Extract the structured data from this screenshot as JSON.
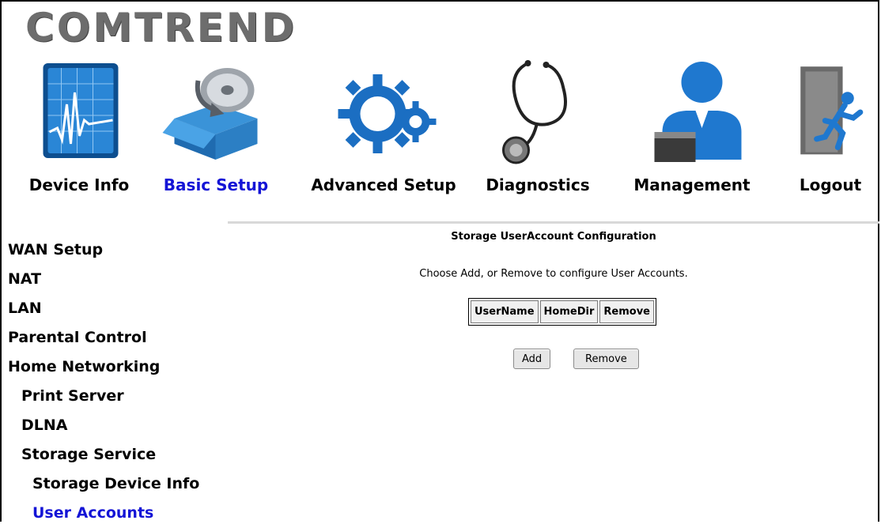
{
  "brand": {
    "logo_text": "COMTREND"
  },
  "nav": {
    "items": [
      {
        "label": "Device Info",
        "icon": "device-info-monitor-icon"
      },
      {
        "label": "Basic Setup",
        "icon": "basic-setup-box-disc-icon",
        "active": true
      },
      {
        "label": "Advanced Setup",
        "icon": "advanced-setup-gears-icon"
      },
      {
        "label": "Diagnostics",
        "icon": "diagnostics-stethoscope-icon"
      },
      {
        "label": "Management",
        "icon": "management-user-icon"
      },
      {
        "label": "Logout",
        "icon": "logout-door-runner-icon"
      }
    ]
  },
  "sidebar": {
    "items": [
      {
        "label": "WAN Setup",
        "level": 0
      },
      {
        "label": "NAT",
        "level": 0
      },
      {
        "label": "LAN",
        "level": 0
      },
      {
        "label": "Parental Control",
        "level": 0
      },
      {
        "label": "Home Networking",
        "level": 0
      },
      {
        "label": "Print Server",
        "level": 1
      },
      {
        "label": "DLNA",
        "level": 1
      },
      {
        "label": "Storage Service",
        "level": 1
      },
      {
        "label": "Storage Device Info",
        "level": 2
      },
      {
        "label": "User Accounts",
        "level": 2,
        "active": true
      }
    ]
  },
  "main": {
    "title": "Storage UserAccount Configuration",
    "description": "Choose Add, or Remove to configure User Accounts.",
    "table": {
      "columns": [
        "UserName",
        "HomeDir",
        "Remove"
      ],
      "rows": []
    },
    "buttons": {
      "add": "Add",
      "remove": "Remove"
    }
  },
  "colors": {
    "active_link": "#1414d6",
    "text": "#000000",
    "logo": "#6d6d6d"
  }
}
